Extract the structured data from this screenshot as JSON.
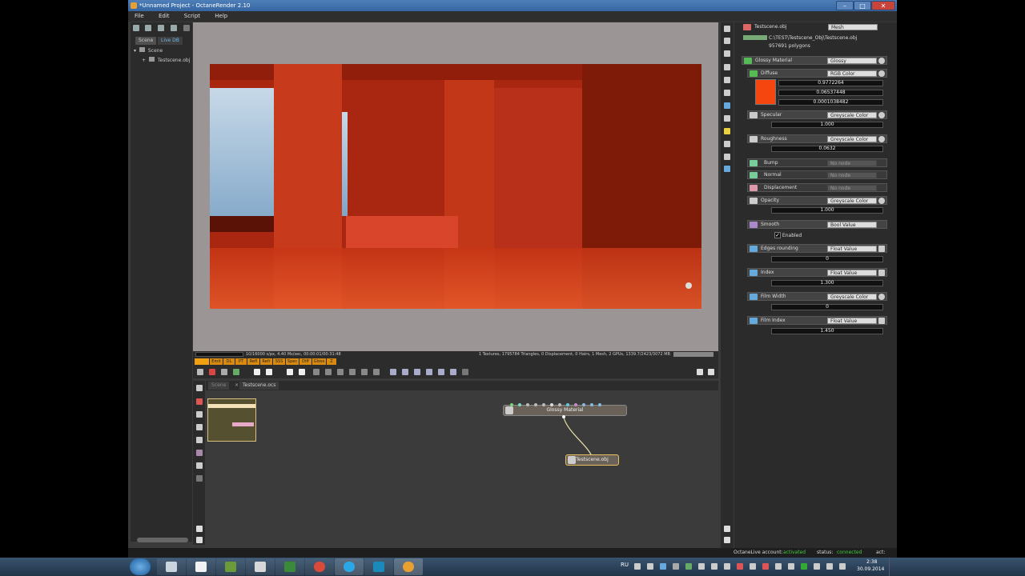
{
  "window": {
    "title": "*Unnamed Project - OctaneRender 2.10"
  },
  "menu": {
    "file": "File",
    "edit": "Edit",
    "script": "Script",
    "help": "Help"
  },
  "scene_tabs": {
    "scene": "Scene",
    "live_db": "Live DB"
  },
  "scene_tree": {
    "root": "Scene",
    "child": "Testscene.obj"
  },
  "viewport": {
    "render_stats": "10/16000 s/px, 4.40 Ms/sec, 00:00:01/00:31:48",
    "scene_stats": "1 Textures, 1795784 Triangles, 0 Displacement, 0 Hairs, 1 Mesh, 2 GPUs, 1339.7/2423/3072 MB"
  },
  "passes": [
    "Emit",
    "DL",
    "PT",
    "Refl",
    "Refr",
    "SSS",
    "Spec",
    "Diff",
    "Gloss",
    "Z"
  ],
  "graph": {
    "tab_scene": "Scene",
    "tab_file": "Testscene.ocs",
    "node_material": "Glossy Material",
    "node_mesh": "Testscene.obj"
  },
  "inspector": {
    "node_name": "Testscene.obj",
    "node_type": "Mesh",
    "path": "C:\\TEST\\Testscene_Obj\\Testscene.obj",
    "polygons": "957691 polygons",
    "material_label": "Glossy Material",
    "material_type": "Glossy",
    "diffuse": {
      "label": "Diffuse",
      "type": "RGB Color",
      "r": "0.9772264",
      "g": "0.06537448",
      "b": "0.0001038482",
      "swatch": "#f5460f"
    },
    "specular": {
      "label": "Specular",
      "type": "Greyscale Color",
      "value": "1.000"
    },
    "roughness": {
      "label": "Roughness",
      "type": "Greyscale Color",
      "value": "0.0632"
    },
    "bump": {
      "label": "Bump",
      "type": "No node"
    },
    "normal": {
      "label": "Normal",
      "type": "No node"
    },
    "displacement": {
      "label": "Displacement",
      "type": "No node"
    },
    "opacity": {
      "label": "Opacity",
      "type": "Greyscale Color",
      "value": "1.000"
    },
    "smooth": {
      "label": "Smooth",
      "type": "Bool Value",
      "check": "Enabled"
    },
    "edges": {
      "label": "Edges rounding",
      "type": "Float Value",
      "value": "0"
    },
    "index": {
      "label": "Index",
      "type": "Float Value",
      "value": "1.300"
    },
    "film_width": {
      "label": "Film Width",
      "type": "Greyscale Color",
      "value": "0"
    },
    "film_index": {
      "label": "Film Index",
      "type": "Float Value",
      "value": "1.450"
    }
  },
  "statusbar": {
    "account_label": "OctaneLive account:",
    "account_value": "activated",
    "status_label": "status:",
    "status_value": "connected",
    "act_label": "act:"
  },
  "taskbar": {
    "lang": "RU",
    "time": "2:38",
    "date": "30.09.2014"
  },
  "colors": {
    "accent_green": "#3ecf3e",
    "pass_orange": "#d88a10",
    "render_red": "#b52a10"
  }
}
